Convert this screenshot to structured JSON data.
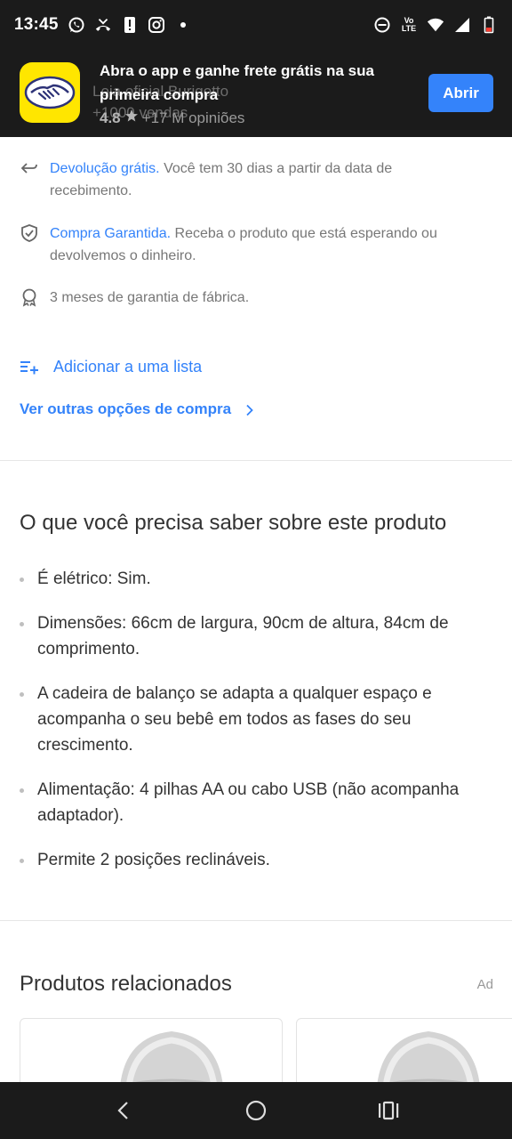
{
  "status_bar": {
    "time": "13:45",
    "left_icons": [
      "whatsapp-icon",
      "missed-call-icon",
      "alert-icon",
      "instagram-icon",
      "dot-icon"
    ],
    "right_icons": [
      "do-not-disturb-icon",
      "volte-icon",
      "wifi-icon",
      "signal-icon",
      "battery-icon"
    ],
    "volte_top": "Vo",
    "volte_bottom": "LTE"
  },
  "app_banner": {
    "message": "Abra o app e ganhe frete grátis na sua primeira compra",
    "under_line1": "Loja oficial Burigotto",
    "under_line2": "+1000 vendas",
    "rating": "4.8",
    "reviews": "+17 M opiniões",
    "open_label": "Abrir",
    "logo_color": "#ffe600",
    "button_color": "#3483fa"
  },
  "benefits": [
    {
      "link": "Devolução grátis.",
      "text": " Você tem 30 dias a partir da data de recebimento.",
      "icon": "return-arrow-icon"
    },
    {
      "link": "Compra Garantida.",
      "text": " Receba o produto que está esperando ou devolvemos o dinheiro.",
      "icon": "shield-check-icon"
    },
    {
      "link": "",
      "text": "3 meses de garantia de fábrica.",
      "icon": "award-ribbon-icon"
    }
  ],
  "actions": {
    "add_to_list": "Adicionar a uma lista",
    "other_options": "Ver outras opções de compra"
  },
  "product_info": {
    "title": "O que você precisa saber sobre este produto",
    "features": [
      "É elétrico: Sim.",
      "Dimensões: 66cm de largura, 90cm de altura, 84cm de comprimento.",
      "A cadeira de balanço se adapta a qualquer espaço e acompanha o seu bebê em todos as fases do seu crescimento.",
      "Alimentação: 4 pilhas AA ou cabo USB (não acompanha adaptador).",
      "Permite 2 posições reclináveis."
    ]
  },
  "related": {
    "title": "Produtos relacionados",
    "ad_label": "Ad"
  },
  "nav_bar": {
    "buttons": [
      "back-icon",
      "home-icon",
      "recent-apps-icon"
    ]
  }
}
